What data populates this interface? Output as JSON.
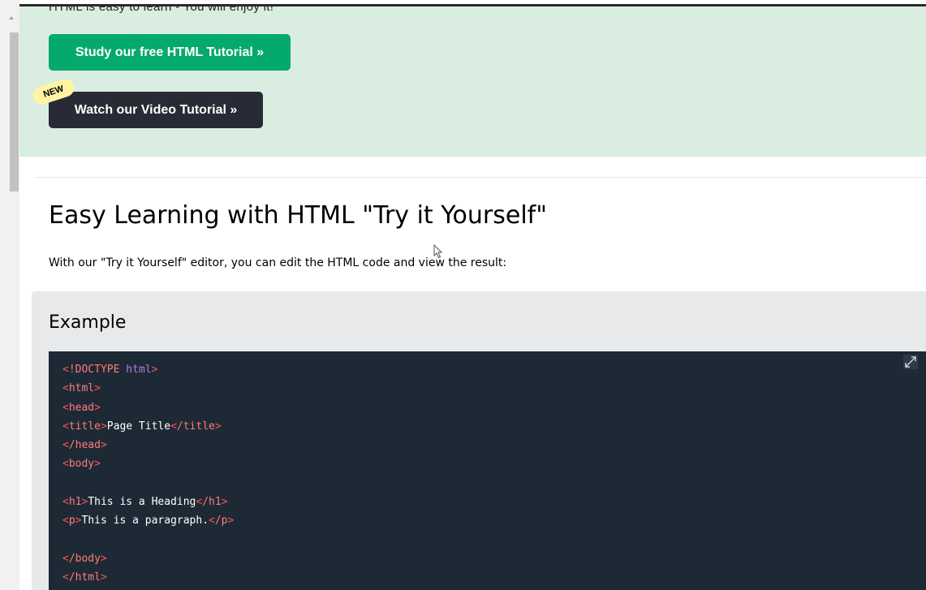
{
  "hero": {
    "cut_text": "HTML is easy to learn - You will enjoy it!",
    "study_button": "Study our free HTML Tutorial »",
    "video_button": "Watch our Video Tutorial »",
    "new_badge": "NEW"
  },
  "section": {
    "heading": "Easy Learning with HTML \"Try it Yourself\"",
    "intro": "With our \"Try it Yourself\" editor, you can edit the HTML code and view the result:"
  },
  "example": {
    "title": "Example",
    "code": {
      "l1_open": "<",
      "l1_kw": "!DOCTYPE",
      "l1_attr": " html",
      "l1_close": ">",
      "l2_tag": "html",
      "l3_tag": "head",
      "l4_tag": "title",
      "l4_text": "Page Title",
      "l4_endtag": "/title",
      "l5_tag": "/head",
      "l6_tag": "body",
      "l8_tag": "h1",
      "l8_text": "This is a Heading",
      "l8_endtag": "/h1",
      "l9_tag": "p",
      "l9_text": "This is a paragraph.",
      "l9_endtag": "/p",
      "l11_tag": "/body",
      "l12_tag": "/html"
    }
  },
  "icons": {
    "expand": "expand-icon",
    "cursor": "mouse-cursor-icon"
  },
  "colors": {
    "hero_bg": "#d9eee1",
    "study_button": "#04aa6d",
    "video_button": "#282a35",
    "badge": "#fff4a3",
    "code_bg": "#1d2a35",
    "example_bg": "#e7e9eb"
  }
}
